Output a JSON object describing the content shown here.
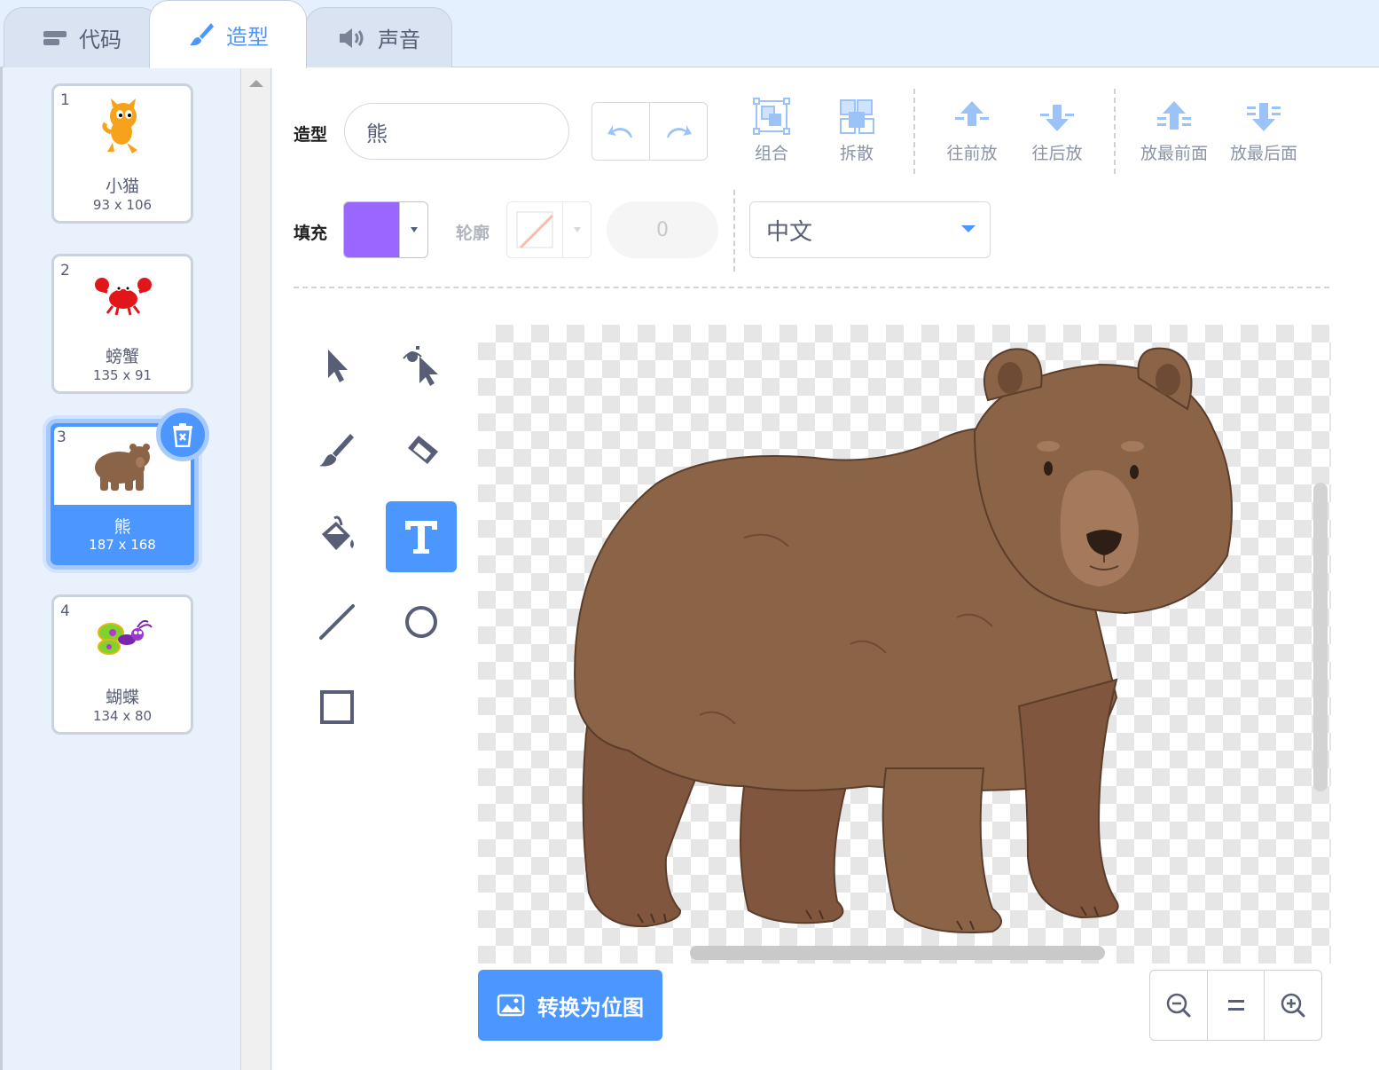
{
  "tabs": [
    {
      "label": "代码",
      "icon": "code-blocks-icon"
    },
    {
      "label": "造型",
      "icon": "paintbrush-icon"
    },
    {
      "label": "声音",
      "icon": "speaker-icon"
    }
  ],
  "costumes": [
    {
      "num": "1",
      "name": "小猫",
      "size": "93 x 106"
    },
    {
      "num": "2",
      "name": "螃蟹",
      "size": "135 x 91"
    },
    {
      "num": "3",
      "name": "熊",
      "size": "187 x 168",
      "selected": true
    },
    {
      "num": "4",
      "name": "蝴蝶",
      "size": "134 x 80"
    }
  ],
  "editor": {
    "costume_label": "造型",
    "costume_name": "熊",
    "toolbar": {
      "group": "组合",
      "ungroup": "拆散",
      "forward": "往前放",
      "backward": "往后放",
      "front": "放最前面",
      "back": "放最后面"
    },
    "fill_label": "填充",
    "fill_color": "#9966FF",
    "outline_label": "轮廓",
    "stroke_width": "0",
    "font": "中文",
    "convert_button": "转换为位图"
  },
  "colors": {
    "accent": "#4C97FF",
    "text": "#575E75",
    "bear_fur": "#8B6448",
    "bear_muzzle": "#A57A5C"
  }
}
